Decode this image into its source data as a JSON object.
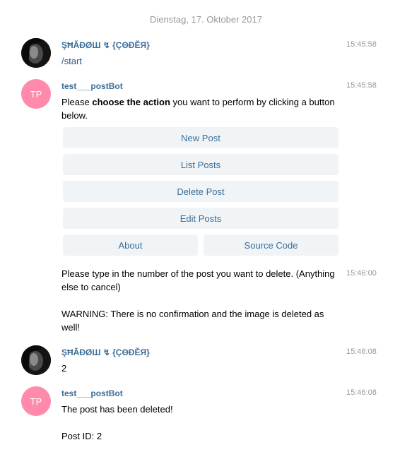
{
  "date_separator": "Dienstag, 17. Oktober 2017",
  "messages": [
    {
      "sender": "ŞĦĂĐØШ ↯ {ÇΘĐĚЯ}",
      "time": "15:45:58",
      "text": "/start"
    },
    {
      "sender": "test___postBot",
      "avatar_initials": "TP",
      "time": "15:45:58",
      "text_pre": "Please ",
      "text_bold": "choose the action",
      "text_post": " you want to perform by clicking a button below."
    },
    {
      "time": "15:46:00",
      "text_line1": "Please type in the number of the post you want to delete. (Anything else to cancel)",
      "text_line2": "WARNING: There is no confirmation and the image is deleted as well!"
    },
    {
      "sender": "ŞĦĂĐØШ ↯ {ÇΘĐĚЯ}",
      "time": "15:46:08",
      "text": "2"
    },
    {
      "sender": "test___postBot",
      "avatar_initials": "TP",
      "time": "15:46:08",
      "text_line1": "The post has been deleted!",
      "text_line2": "Post ID: 2"
    }
  ],
  "keyboard": {
    "new_post": "New Post",
    "list_posts": "List Posts",
    "delete_post": "Delete Post",
    "edit_posts": "Edit Posts",
    "about": "About",
    "source_code": "Source Code"
  },
  "colors": {
    "sender_name": "#3a6d99",
    "avatar_tp": "#ff8aac",
    "button_bg": "#f0f4f7",
    "timestamp": "#999999"
  }
}
